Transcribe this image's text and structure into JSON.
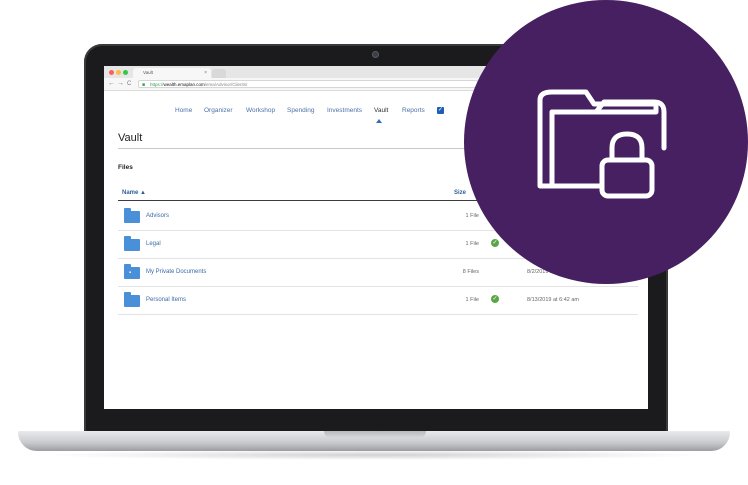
{
  "browser": {
    "tab_title": "Vault",
    "tab_close": "×",
    "url_secure": "https://",
    "url_domain": "wealth.emaplan.com",
    "url_path": "/ema/Advisor/Clients/",
    "nav_back": "←",
    "nav_forward": "→",
    "nav_reload": "C"
  },
  "app_nav": {
    "items": [
      "Home",
      "Organizer",
      "Workshop",
      "Spending",
      "Investments",
      "Vault",
      "Reports"
    ],
    "active": "Vault"
  },
  "page": {
    "title": "Vault",
    "section": "Files"
  },
  "table": {
    "columns": {
      "name": "Name ▲",
      "size": "Size"
    },
    "rows": [
      {
        "name": "Advisors",
        "size": "1 File",
        "status": "",
        "date": "",
        "locked": false
      },
      {
        "name": "Legal",
        "size": "1 File",
        "status": "ok",
        "date": "",
        "locked": false
      },
      {
        "name": "My Private Documents",
        "size": "8 Files",
        "status": "",
        "date": "8/2/2019 at 4",
        "locked": true
      },
      {
        "name": "Personal Items",
        "size": "1 File",
        "status": "ok",
        "date": "8/13/2019 at 6:42 am",
        "locked": false
      }
    ]
  },
  "badge": {
    "icon": "locked-folder-icon",
    "color": "#462060"
  },
  "colors": {
    "link": "#3d6aa6",
    "folder": "#4a90d9",
    "status_ok": "#5aa647"
  }
}
